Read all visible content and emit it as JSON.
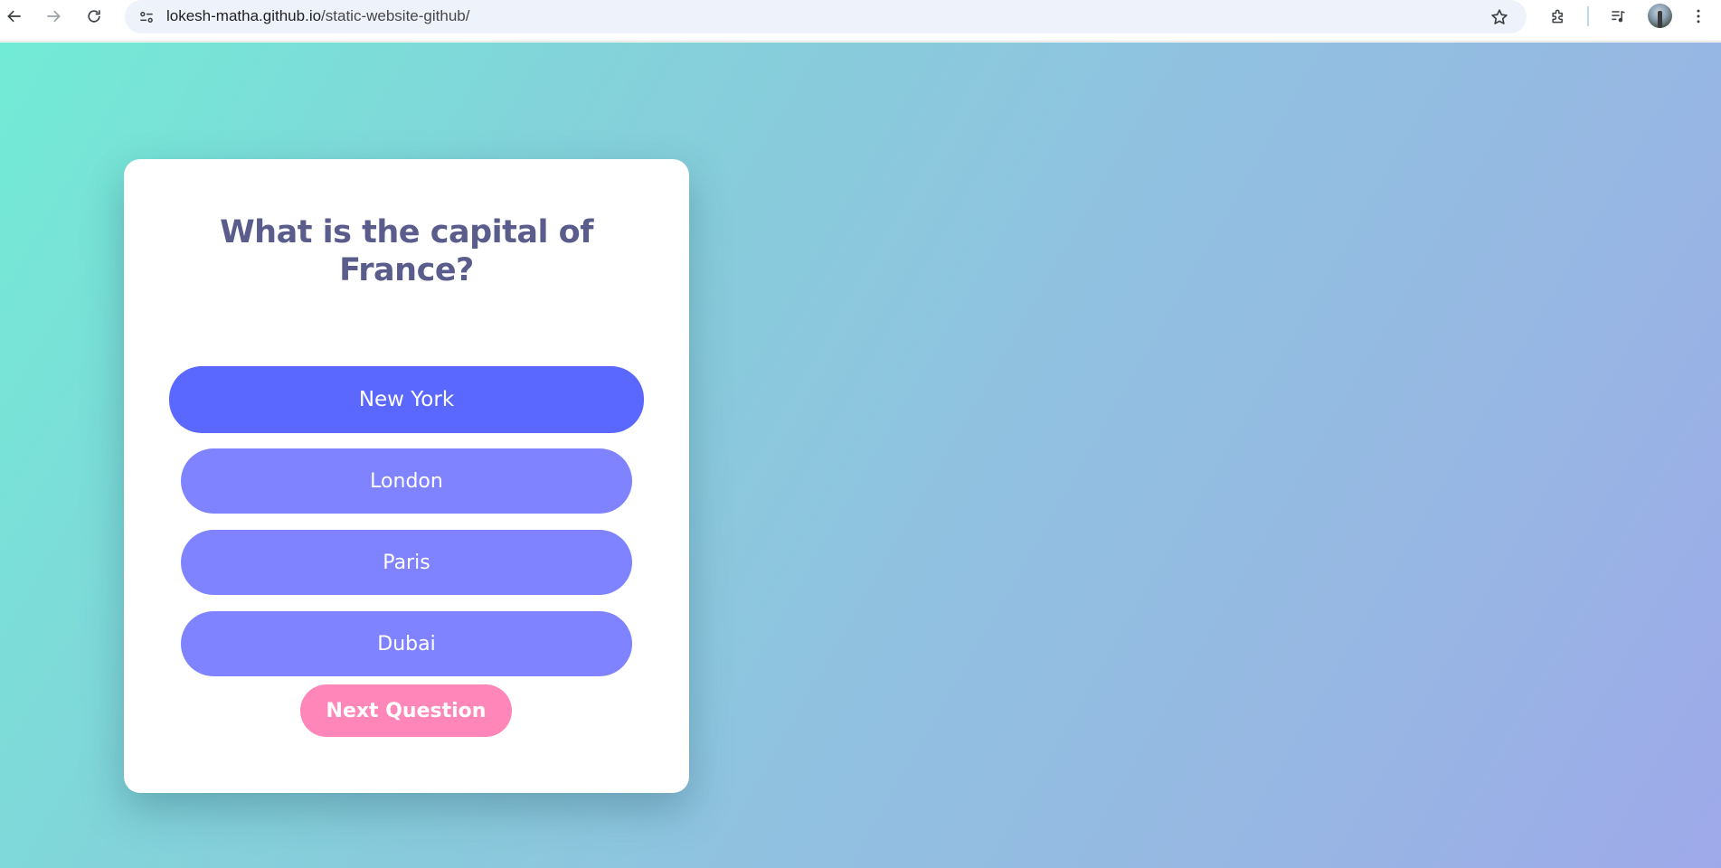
{
  "browser": {
    "url_host": "lokesh-matha.github.io",
    "url_path": "/static-website-github/",
    "icons": [
      "back-icon",
      "forward-icon",
      "reload-icon",
      "site-info-icon",
      "star-icon",
      "extensions-icon",
      "media-icon",
      "avatar",
      "menu-icon"
    ]
  },
  "quiz": {
    "question": "What is the capital of France?",
    "answers": [
      {
        "label": "New York",
        "state": "hover"
      },
      {
        "label": "London",
        "state": "default"
      },
      {
        "label": "Paris",
        "state": "default"
      },
      {
        "label": "Dubai",
        "state": "default"
      }
    ],
    "next_label": "Next Question"
  },
  "colors": {
    "answer_default": "#8083ff",
    "answer_hover": "#5b68ff",
    "next_button": "#ff86b8",
    "question_text": "#5a5c8c",
    "background_start": "#72ebd6",
    "background_end": "#9ea9ea"
  }
}
